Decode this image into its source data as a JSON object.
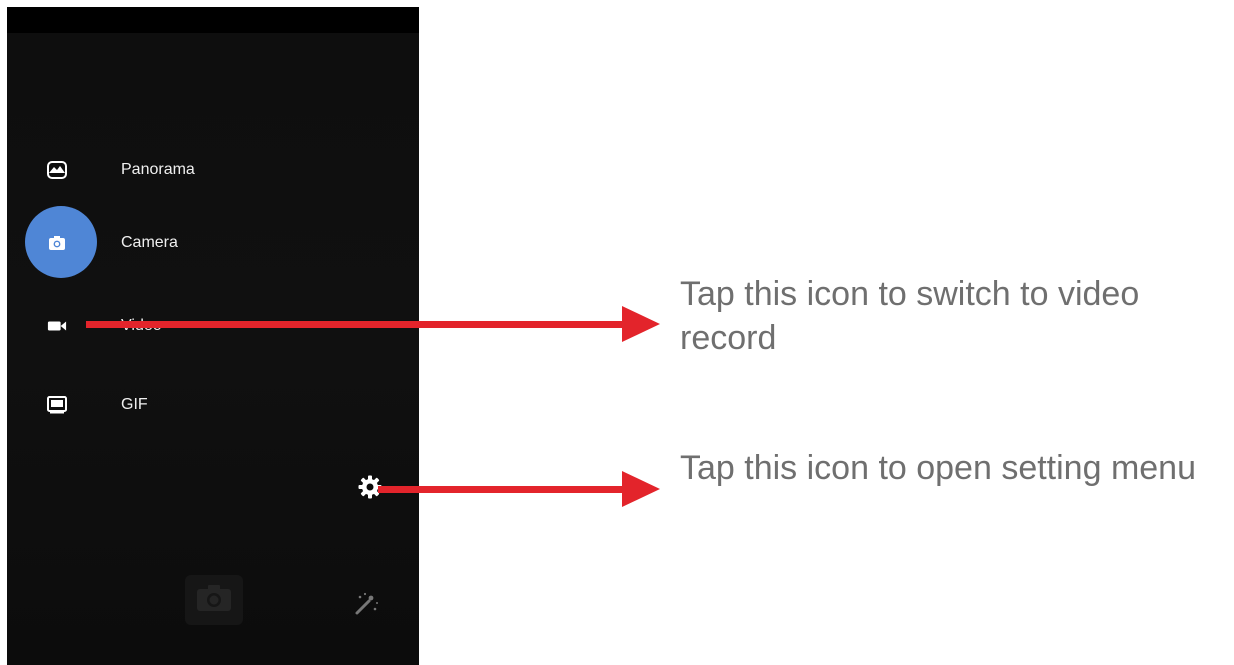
{
  "camera_app": {
    "modes": [
      {
        "label": "Panorama",
        "icon": "panorama-icon"
      },
      {
        "label": "Camera",
        "icon": "camera-icon"
      },
      {
        "label": "Video",
        "icon": "video-camera-icon"
      },
      {
        "label": "GIF",
        "icon": "gif-icon"
      }
    ],
    "selected_mode": "Camera",
    "controls": {
      "settings_icon": "gear-icon",
      "shutter_icon": "camera-shutter-icon",
      "effects_icon": "magic-wand-icon"
    }
  },
  "annotations": {
    "video_note": "Tap this icon to switch to video record",
    "settings_note": "Tap this icon to open setting menu"
  },
  "colors": {
    "accent_blue": "#4f86d6",
    "arrow_red": "#e3242b",
    "annotation_text": "#6f6f6f",
    "background_dark": "#0b0b0b"
  }
}
